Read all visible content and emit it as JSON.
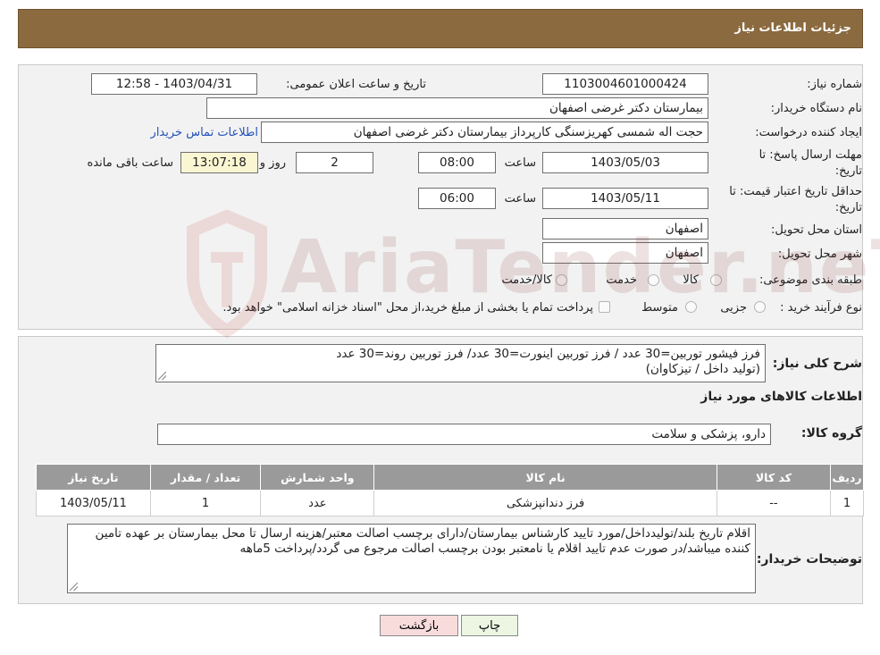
{
  "header": {
    "title": "جزئیات اطلاعات نیاز"
  },
  "form": {
    "need_number_label": "شماره نیاز:",
    "need_number": "1103004601000424",
    "announce_label": "تاریخ و ساعت اعلان عمومی:",
    "announce_value": "1403/04/31 - 12:58",
    "buyer_label": "نام دستگاه خریدار:",
    "buyer_value": "بیمارستان دکتر غرضی اصفهان",
    "creator_label": "ایجاد کننده درخواست:",
    "creator_value": "حجت اله شمسی کهریزسنگی کارپرداز بیمارستان دکتر غرضی اصفهان",
    "contact_link": "اطلاعات تماس خریدار",
    "deadline_label_1": "مهلت ارسال پاسخ: تا",
    "deadline_label_2": "تاریخ:",
    "deadline_date": "1403/05/03",
    "time_label": "ساعت",
    "deadline_time": "08:00",
    "days_value": "2",
    "days_label": "روز و",
    "remaining_time": "13:07:18",
    "remaining_label": "ساعت باقی مانده",
    "validity_label_1": "حداقل تاریخ اعتبار قیمت: تا",
    "validity_label_2": "تاریخ:",
    "validity_date": "1403/05/11",
    "validity_time": "06:00",
    "province_label": "استان محل تحویل:",
    "province_value": "اصفهان",
    "city_label": "شهر محل تحویل:",
    "city_value": "اصفهان",
    "category_label": "طبقه بندی موضوعی:",
    "category_options": [
      "کالا",
      "خدمت",
      "کالا/خدمت"
    ],
    "process_label": "نوع فرآیند خرید :",
    "process_options": [
      "جزیی",
      "متوسط"
    ],
    "process_note": "پرداخت تمام یا بخشی از مبلغ خرید،از محل \"اسناد خزانه اسلامی\" خواهد بود."
  },
  "summary": {
    "label": "شرح کلی نیاز:",
    "line1": "فرز فیشور توربین=30 عدد / فرز توربین اینورت=30 عدد/ فرز توربین روند=30 عدد",
    "line2": "(تولید داخل / تیزکاوان)"
  },
  "goods": {
    "section_title": "اطلاعات کالاهای مورد نیاز",
    "group_label": "گروه کالا:",
    "group_value": "دارو، پزشکی و سلامت",
    "table": {
      "headers": [
        "ردیف",
        "کد کالا",
        "نام کالا",
        "واحد شمارش",
        "تعداد / مقدار",
        "تاریخ نیاز"
      ],
      "rows": [
        [
          "1",
          "--",
          "فرز دندانپزشکی",
          "عدد",
          "1",
          "1403/05/11"
        ]
      ]
    }
  },
  "buyer_notes": {
    "label": "توضیحات خریدار:",
    "text": "اقلام تاریخ بلند/تولیدداخل/مورد تایید کارشناس بیمارستان/دارای برچسب اصالت معتبر/هزینه ارسال تا محل بیمارستان بر عهده تامین کننده میباشد/در صورت عدم تایید اقلام یا نامعتبر بودن برچسب اصالت مرجوع می گردد/پرداخت 5ماهه"
  },
  "buttons": {
    "print": "چاپ",
    "back": "بازگشت"
  },
  "watermark": {
    "text": "AriaTender.neT"
  },
  "colors": {
    "header_bg": "#8b6a3f",
    "link": "#2451b8",
    "back_button_bg": "#f8dcdc",
    "print_button_bg": "#ecf6e2"
  }
}
